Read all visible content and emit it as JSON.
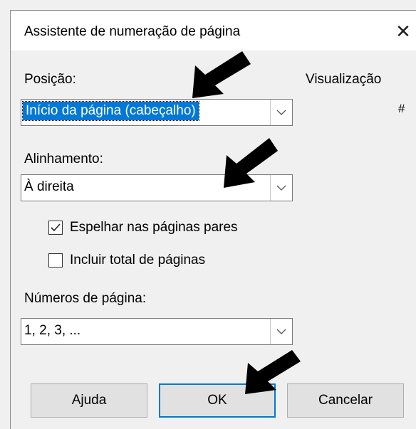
{
  "dialog": {
    "title": "Assistente de numeração de página",
    "close_label": "✕"
  },
  "position": {
    "label": "Posição:",
    "value": "Início da página (cabeçalho)"
  },
  "preview": {
    "label": "Visualização",
    "symbol": "#"
  },
  "alignment": {
    "label": "Alinhamento:",
    "value": "À direita"
  },
  "options": {
    "mirror_label": "Espelhar nas páginas pares",
    "mirror_checked": true,
    "total_label": "Incluir total de páginas",
    "total_checked": false
  },
  "numbers": {
    "label": "Números de página:",
    "value": "1, 2, 3, ..."
  },
  "buttons": {
    "help": "Ajuda",
    "ok": "OK",
    "cancel": "Cancelar"
  },
  "icons": {
    "close": "close-icon",
    "dropdown": "chevron-down-icon",
    "check": "checkmark-icon",
    "pointer": "arrow-pointer-icon"
  }
}
